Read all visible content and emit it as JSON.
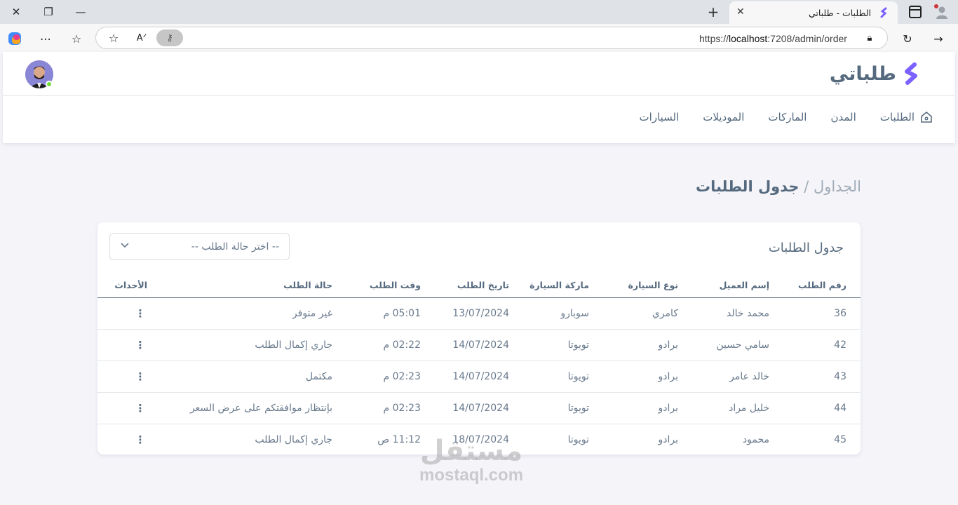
{
  "browser": {
    "tab_title": "الطلبات - طلباتي",
    "url_prefix": "https://",
    "url_host": "localhost",
    "url_rest": ":7208/admin/order"
  },
  "brand": {
    "name": "طلباتي",
    "color": "#7b61ff"
  },
  "menu": [
    {
      "label": "الطلبات",
      "icon": "home-icon"
    },
    {
      "label": "المدن"
    },
    {
      "label": "الماركات"
    },
    {
      "label": "الموديلات"
    },
    {
      "label": "السيارات"
    }
  ],
  "breadcrumb": {
    "parent": "الجداول",
    "separator": "/",
    "current": "جدول الطلبات"
  },
  "card": {
    "title": "جدول الطلبات",
    "status_select_placeholder": "-- اختر حالة الطلب --"
  },
  "table": {
    "headers": [
      "رقم الطلب",
      "إسم العميل",
      "نوع السيارة",
      "ماركة السيارة",
      "تاريخ الطلب",
      "وقت الطلب",
      "حالة الطلب",
      "الأحداث"
    ],
    "rows": [
      [
        "36",
        "محمد خالد",
        "كامري",
        "سوبارو",
        "13/07/2024",
        "05:01 م",
        "غير متوفر"
      ],
      [
        "42",
        "سامي حسين",
        "برادو",
        "تويوتا",
        "14/07/2024",
        "02:22 م",
        "جاري إكمال الطلب"
      ],
      [
        "43",
        "خالد عامر",
        "برادو",
        "تويوتا",
        "14/07/2024",
        "02:23 م",
        "مكتمل"
      ],
      [
        "44",
        "خليل مراد",
        "برادو",
        "تويوتا",
        "14/07/2024",
        "02:23 م",
        "بإنتظار موافقتكم على عرض السعر"
      ],
      [
        "45",
        "محمود",
        "برادو",
        "تويوتا",
        "18/07/2024",
        "11:12 ص",
        "جاري إكمال الطلب"
      ]
    ]
  },
  "watermark": {
    "arabic": "مستقل",
    "latin": "mostaql.com"
  }
}
